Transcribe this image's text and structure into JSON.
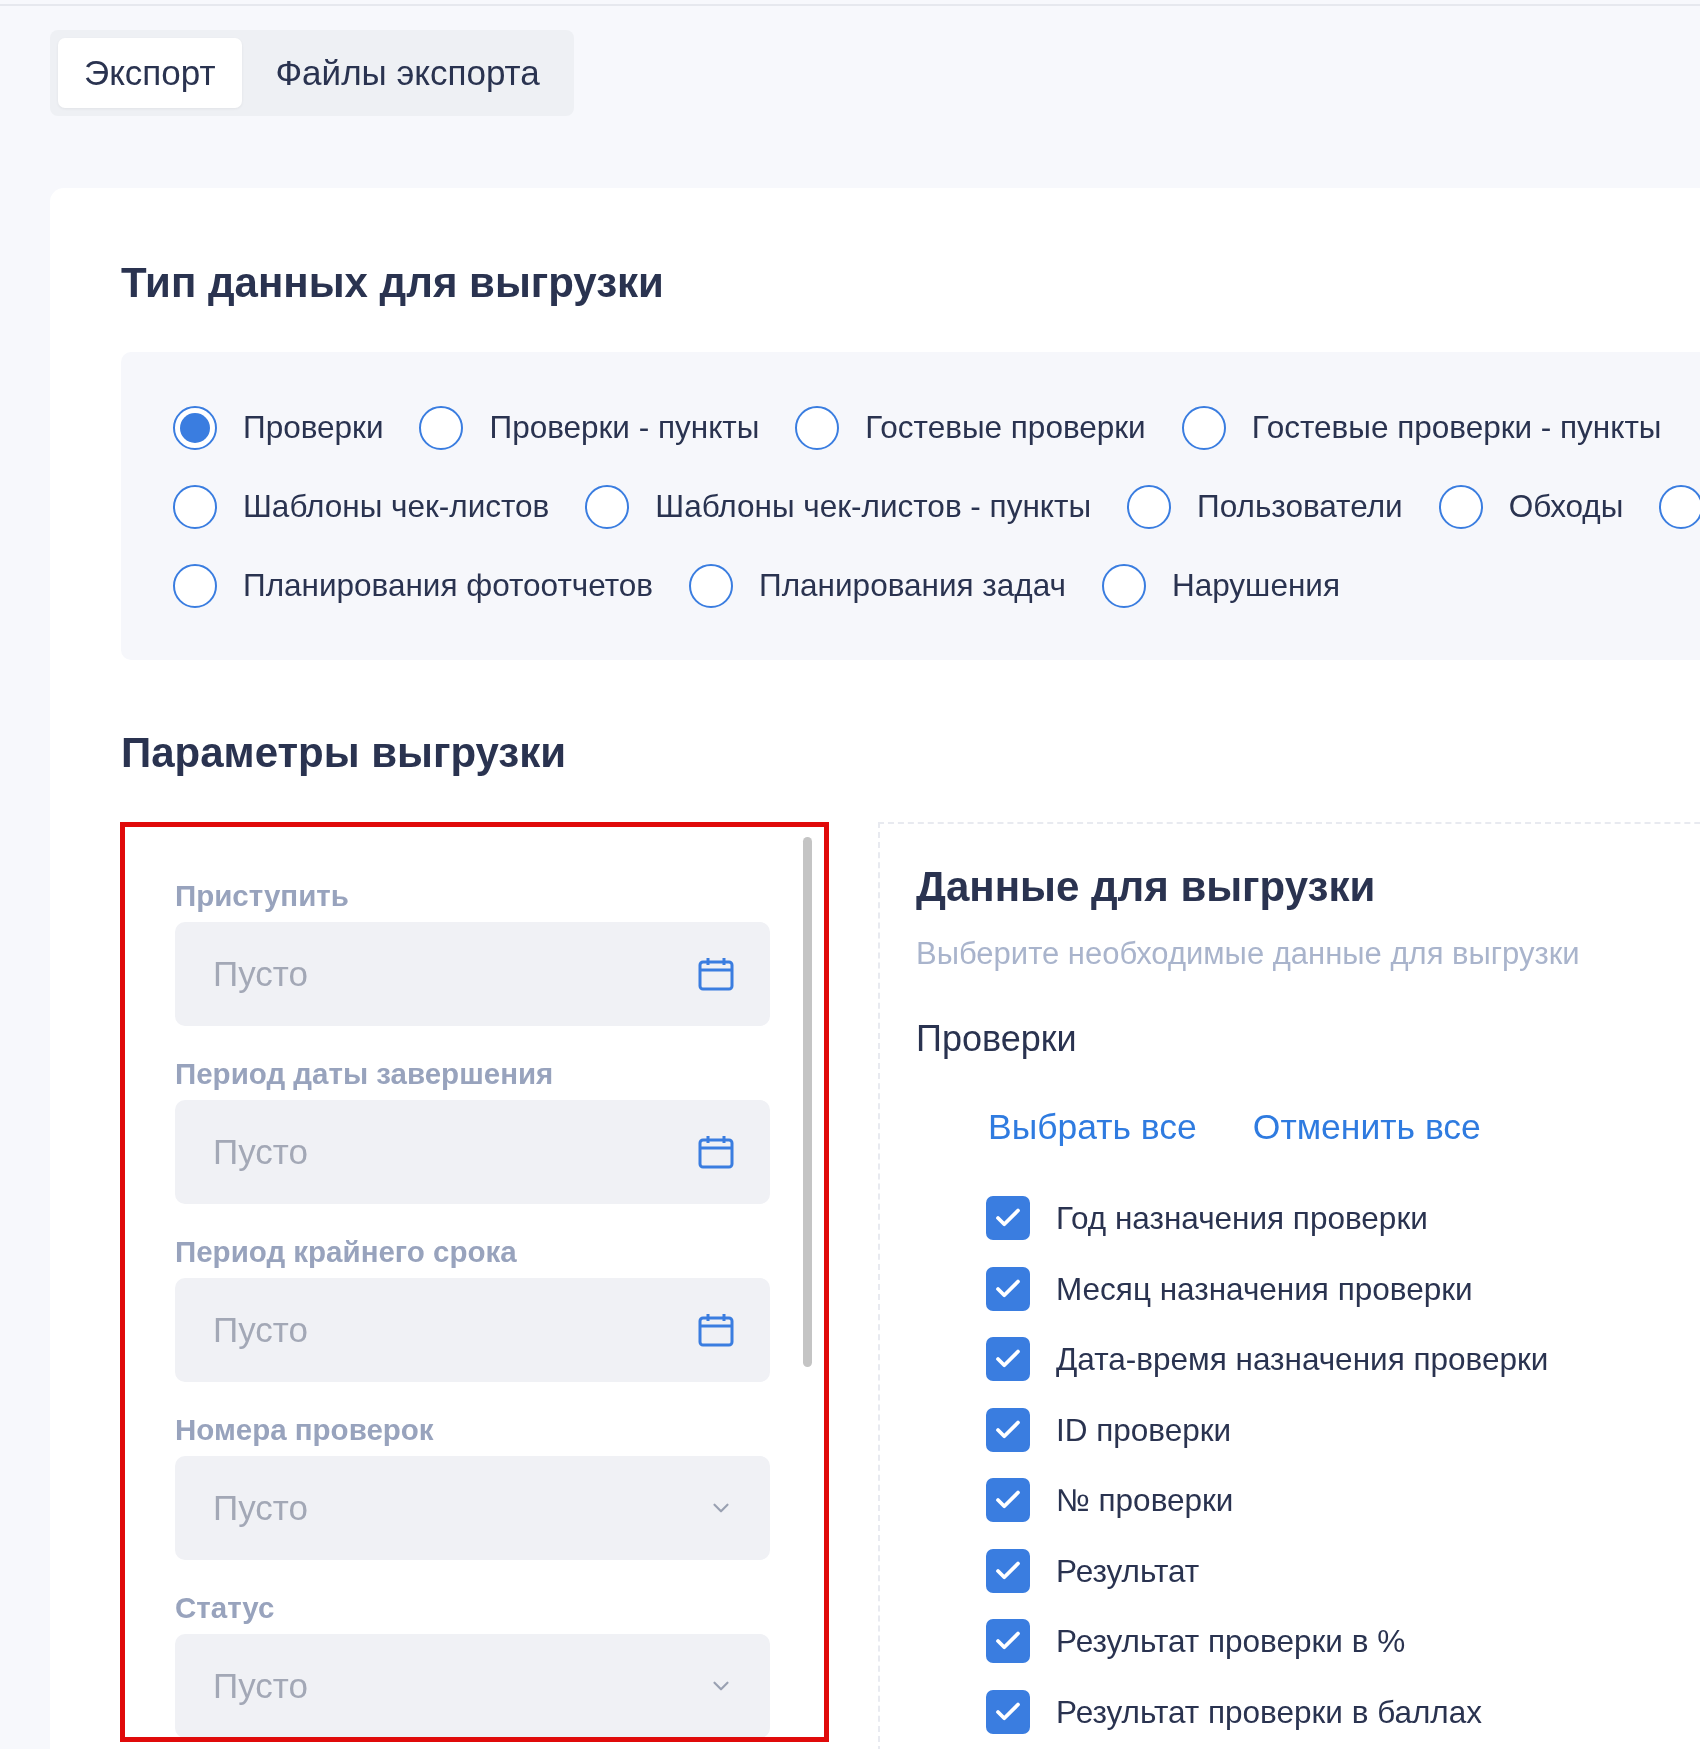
{
  "tabs": [
    {
      "label": "Экспорт",
      "selected": true
    },
    {
      "label": "Файлы экспорта",
      "selected": false
    }
  ],
  "data_type": {
    "title": "Тип данных для выгрузки",
    "options": [
      {
        "label": "Проверки",
        "selected": true
      },
      {
        "label": "Проверки - пункты",
        "selected": false
      },
      {
        "label": "Гостевые проверки",
        "selected": false
      },
      {
        "label": "Гостевые проверки - пункты",
        "selected": false
      },
      {
        "label": "Шаблоны чек-листов",
        "selected": false
      },
      {
        "label": "Шаблоны чек-листов - пункты",
        "selected": false
      },
      {
        "label": "Пользователи",
        "selected": false
      },
      {
        "label": "Обходы",
        "selected": false
      },
      {
        "selected": false
      },
      {
        "label": "Планирования фотоотчетов",
        "selected": false
      },
      {
        "label": "Планирования задач",
        "selected": false
      },
      {
        "label": "Нарушения",
        "selected": false
      }
    ]
  },
  "params": {
    "title": "Параметры выгрузки",
    "filters": [
      {
        "label": "Приступить",
        "kind": "date",
        "placeholder": "Пусто"
      },
      {
        "label": "Период даты завершения",
        "kind": "date",
        "placeholder": "Пусто"
      },
      {
        "label": "Период крайнего срока",
        "kind": "date",
        "placeholder": "Пусто"
      },
      {
        "label": "Номера проверок",
        "kind": "select",
        "placeholder": "Пусто"
      },
      {
        "label": "Статус",
        "kind": "select",
        "placeholder": "Пусто"
      }
    ]
  },
  "export_data": {
    "title": "Данные для выгрузки",
    "subtitle": "Выберите необходимые данные для выгрузки",
    "group": "Проверки",
    "select_all": "Выбрать все",
    "deselect_all": "Отменить все",
    "items": [
      {
        "label": "Год назначения проверки",
        "checked": true
      },
      {
        "label": "Месяц назначения проверки",
        "checked": true
      },
      {
        "label": "Дата-время назначения проверки",
        "checked": true
      },
      {
        "label": "ID проверки",
        "checked": true
      },
      {
        "label": "№ проверки",
        "checked": true
      },
      {
        "label": "Результат",
        "checked": true
      },
      {
        "label": "Результат проверки в %",
        "checked": true
      },
      {
        "label": "Результат проверки в баллах",
        "checked": true
      }
    ]
  }
}
